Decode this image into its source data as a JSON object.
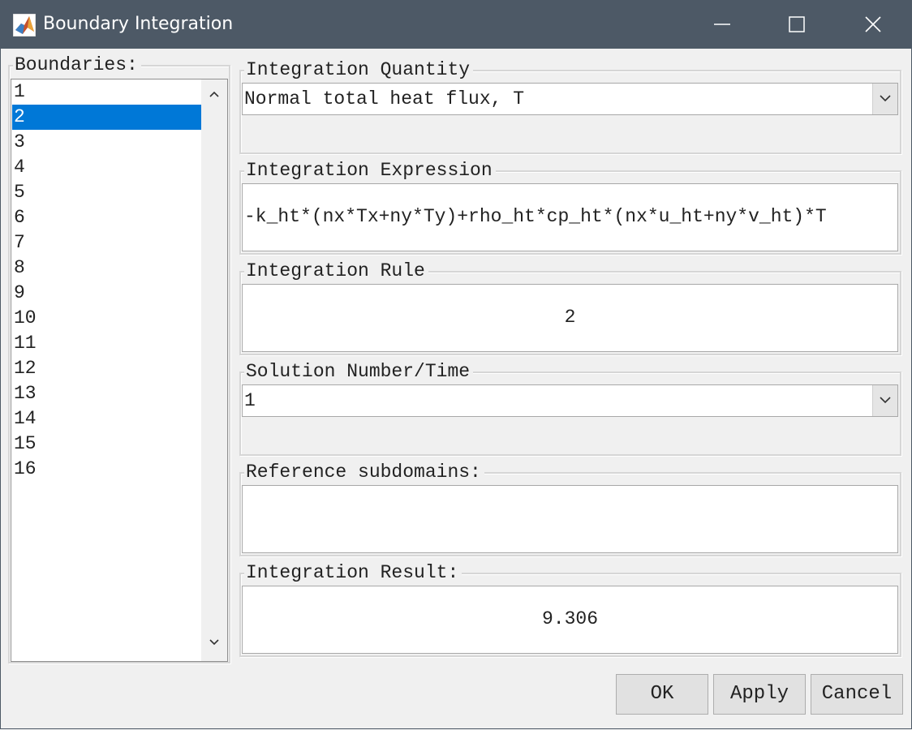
{
  "window": {
    "title": "Boundary Integration",
    "app_icon": "matlab-icon",
    "controls": [
      "minimize-icon",
      "maximize-icon",
      "close-icon"
    ]
  },
  "boundaries": {
    "label": "Boundaries:",
    "items": [
      "1",
      "2",
      "3",
      "4",
      "5",
      "6",
      "7",
      "8",
      "9",
      "10",
      "11",
      "12",
      "13",
      "14",
      "15",
      "16"
    ],
    "selected": "2"
  },
  "integration_quantity": {
    "label": "Integration Quantity",
    "value": "Normal total heat flux, T"
  },
  "integration_expression": {
    "label": "Integration Expression",
    "value": "-k_ht*(nx*Tx+ny*Ty)+rho_ht*cp_ht*(nx*u_ht+ny*v_ht)*T"
  },
  "integration_rule": {
    "label": "Integration Rule",
    "value": "2"
  },
  "solution": {
    "label": "Solution Number/Time",
    "value": "1"
  },
  "reference_subdomains": {
    "label": "Reference subdomains:",
    "value": ""
  },
  "integration_result": {
    "label": "Integration Result:",
    "value": "9.306"
  },
  "buttons": {
    "ok": "OK",
    "apply": "Apply",
    "cancel": "Cancel"
  },
  "colors": {
    "titlebar": "#4d5966",
    "selection": "#0078d7",
    "background": "#f0f0f0"
  }
}
